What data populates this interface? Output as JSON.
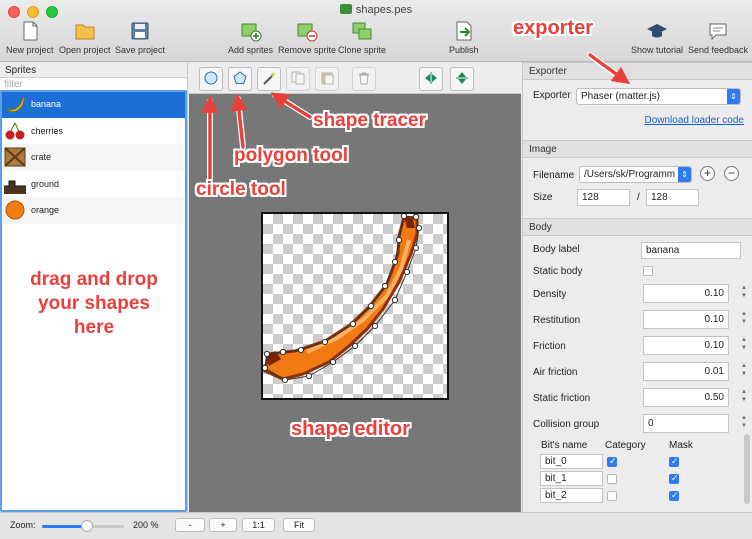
{
  "window": {
    "title": "shapes.pes"
  },
  "toolbar": {
    "new_project": "New project",
    "open_project": "Open project",
    "save_project": "Save project",
    "add_sprites": "Add sprites",
    "remove_sprite": "Remove sprite",
    "clone_sprite": "Clone sprite",
    "publish": "Publish",
    "show_tutorial": "Show tutorial",
    "send_feedback": "Send feedback"
  },
  "sprites": {
    "header": "Sprites",
    "filter_placeholder": "filter",
    "items": [
      {
        "label": "banana",
        "icon": "banana-icon",
        "selected": true
      },
      {
        "label": "cherries",
        "icon": "cherries-icon"
      },
      {
        "label": "crate",
        "icon": "crate-icon"
      },
      {
        "label": "ground",
        "icon": "ground-icon"
      },
      {
        "label": "orange",
        "icon": "orange-icon"
      }
    ]
  },
  "exporter": {
    "header": "Exporter",
    "label": "Exporter",
    "value": "Phaser (matter.js)",
    "download_link": "Download loader code"
  },
  "image": {
    "header": "Image",
    "filename_label": "Filename",
    "filename_value": "/Users/sk/Programm",
    "size_label": "Size",
    "width": "128",
    "separator": "/",
    "height": "128"
  },
  "body": {
    "header": "Body",
    "body_label_label": "Body label",
    "body_label_value": "banana",
    "static_body_label": "Static body",
    "density_label": "Density",
    "density_value": "0.10",
    "restitution_label": "Restitution",
    "restitution_value": "0.10",
    "friction_label": "Friction",
    "friction_value": "0.10",
    "air_friction_label": "Air friction",
    "air_friction_value": "0.01",
    "static_friction_label": "Static friction",
    "static_friction_value": "0.50",
    "collision_group_label": "Collision group",
    "collision_group_value": "0",
    "bits_headers": {
      "name": "Bit's name",
      "category": "Category",
      "mask": "Mask"
    },
    "bits": [
      {
        "name": "bit_0",
        "category": true,
        "mask": true
      },
      {
        "name": "bit_1",
        "category": false,
        "mask": true
      },
      {
        "name": "bit_2",
        "category": false,
        "mask": true
      }
    ]
  },
  "status": {
    "zoom_label": "Zoom:",
    "zoom_value": "200 %",
    "zoom_fraction": 0.55,
    "minus": "-",
    "plus": "+",
    "one_to_one": "1:1",
    "fit": "Fit"
  },
  "annotations": {
    "exporter": "exporter",
    "shape_tracer": "shape tracer",
    "polygon_tool": "polygon tool",
    "circle_tool": "circle tool",
    "drag_drop": [
      "drag and drop",
      "your shapes",
      "here"
    ],
    "shape_editor": "shape editor"
  },
  "colors": {
    "accent": "#1d6fd8",
    "annotation": "#e8413c"
  }
}
